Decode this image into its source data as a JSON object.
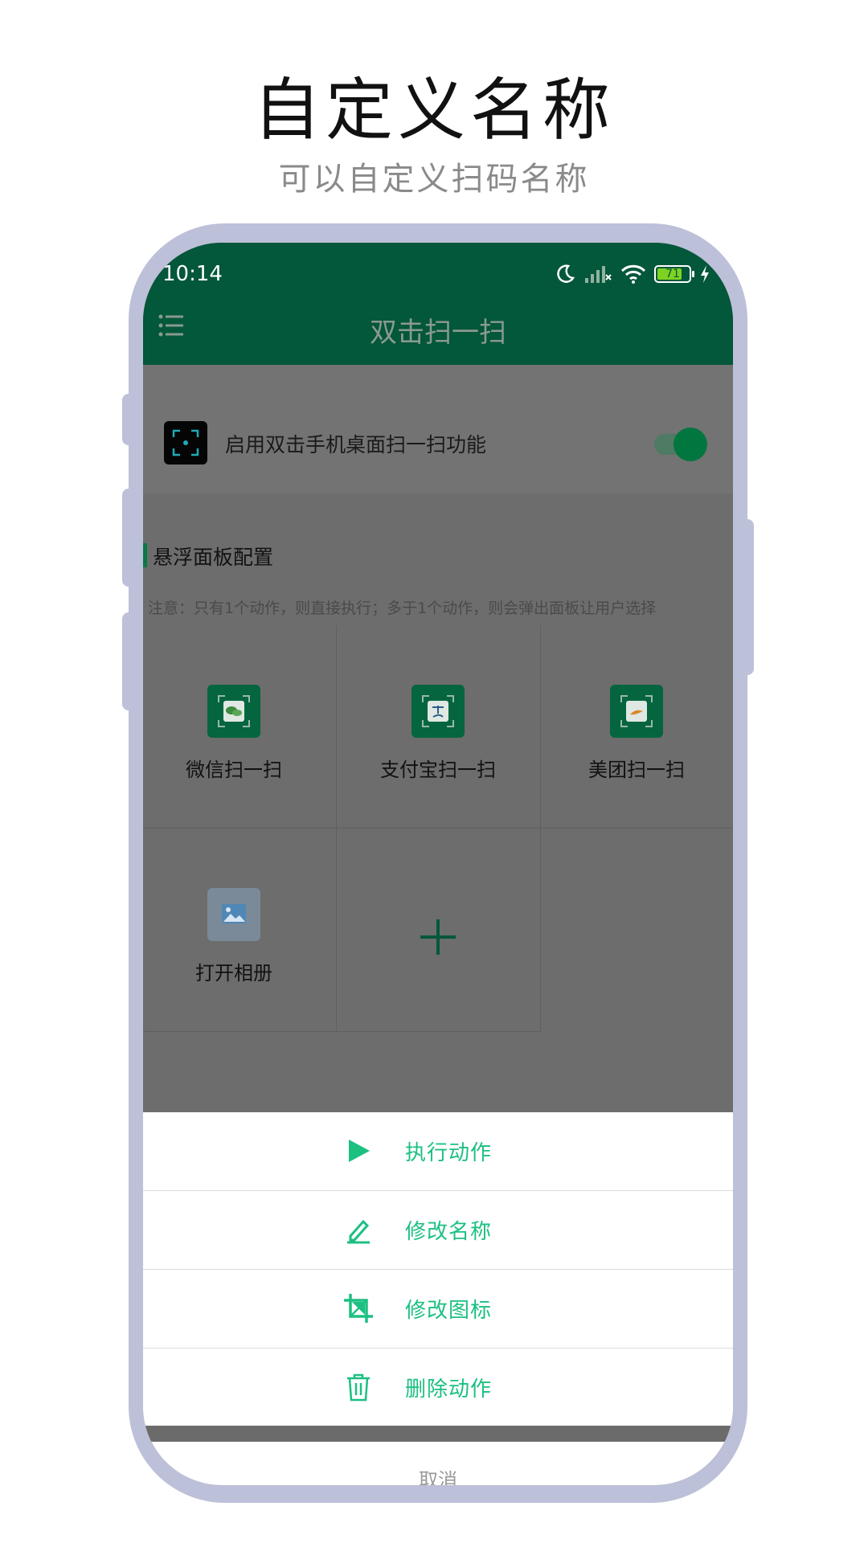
{
  "promo": {
    "title": "自定义名称",
    "subtitle": "可以自定义扫码名称"
  },
  "status_bar": {
    "time": "10:14",
    "battery": "71",
    "icons": [
      "moon-icon",
      "signal-icon",
      "wifi-icon",
      "battery-icon",
      "charging-icon"
    ]
  },
  "app_bar": {
    "menu_icon": "menu-icon",
    "title": "双击扫一扫"
  },
  "settings": {
    "enable_label": "启用双击手机桌面扫一扫功能",
    "enable_on": true,
    "section_title": "悬浮面板配置",
    "note": "注意：只有1个动作，则直接执行；多于1个动作，则会弹出面板让用户选择"
  },
  "actions_grid": [
    {
      "label": "微信扫一扫",
      "icon": "wechat-scan-icon"
    },
    {
      "label": "支付宝扫一扫",
      "icon": "alipay-scan-icon"
    },
    {
      "label": "美团扫一扫",
      "icon": "meituan-scan-icon"
    },
    {
      "label": "打开相册",
      "icon": "gallery-icon"
    },
    {
      "label": "",
      "icon": "plus-icon"
    }
  ],
  "action_sheet": {
    "items": [
      {
        "label": "执行动作",
        "icon": "play-icon"
      },
      {
        "label": "修改名称",
        "icon": "edit-icon"
      },
      {
        "label": "修改图标",
        "icon": "crop-icon"
      },
      {
        "label": "删除动作",
        "icon": "trash-icon"
      }
    ],
    "cancel": "取消"
  },
  "colors": {
    "primary": "#03573a",
    "accent": "#1cc081",
    "frame": "#bcc0d8"
  }
}
